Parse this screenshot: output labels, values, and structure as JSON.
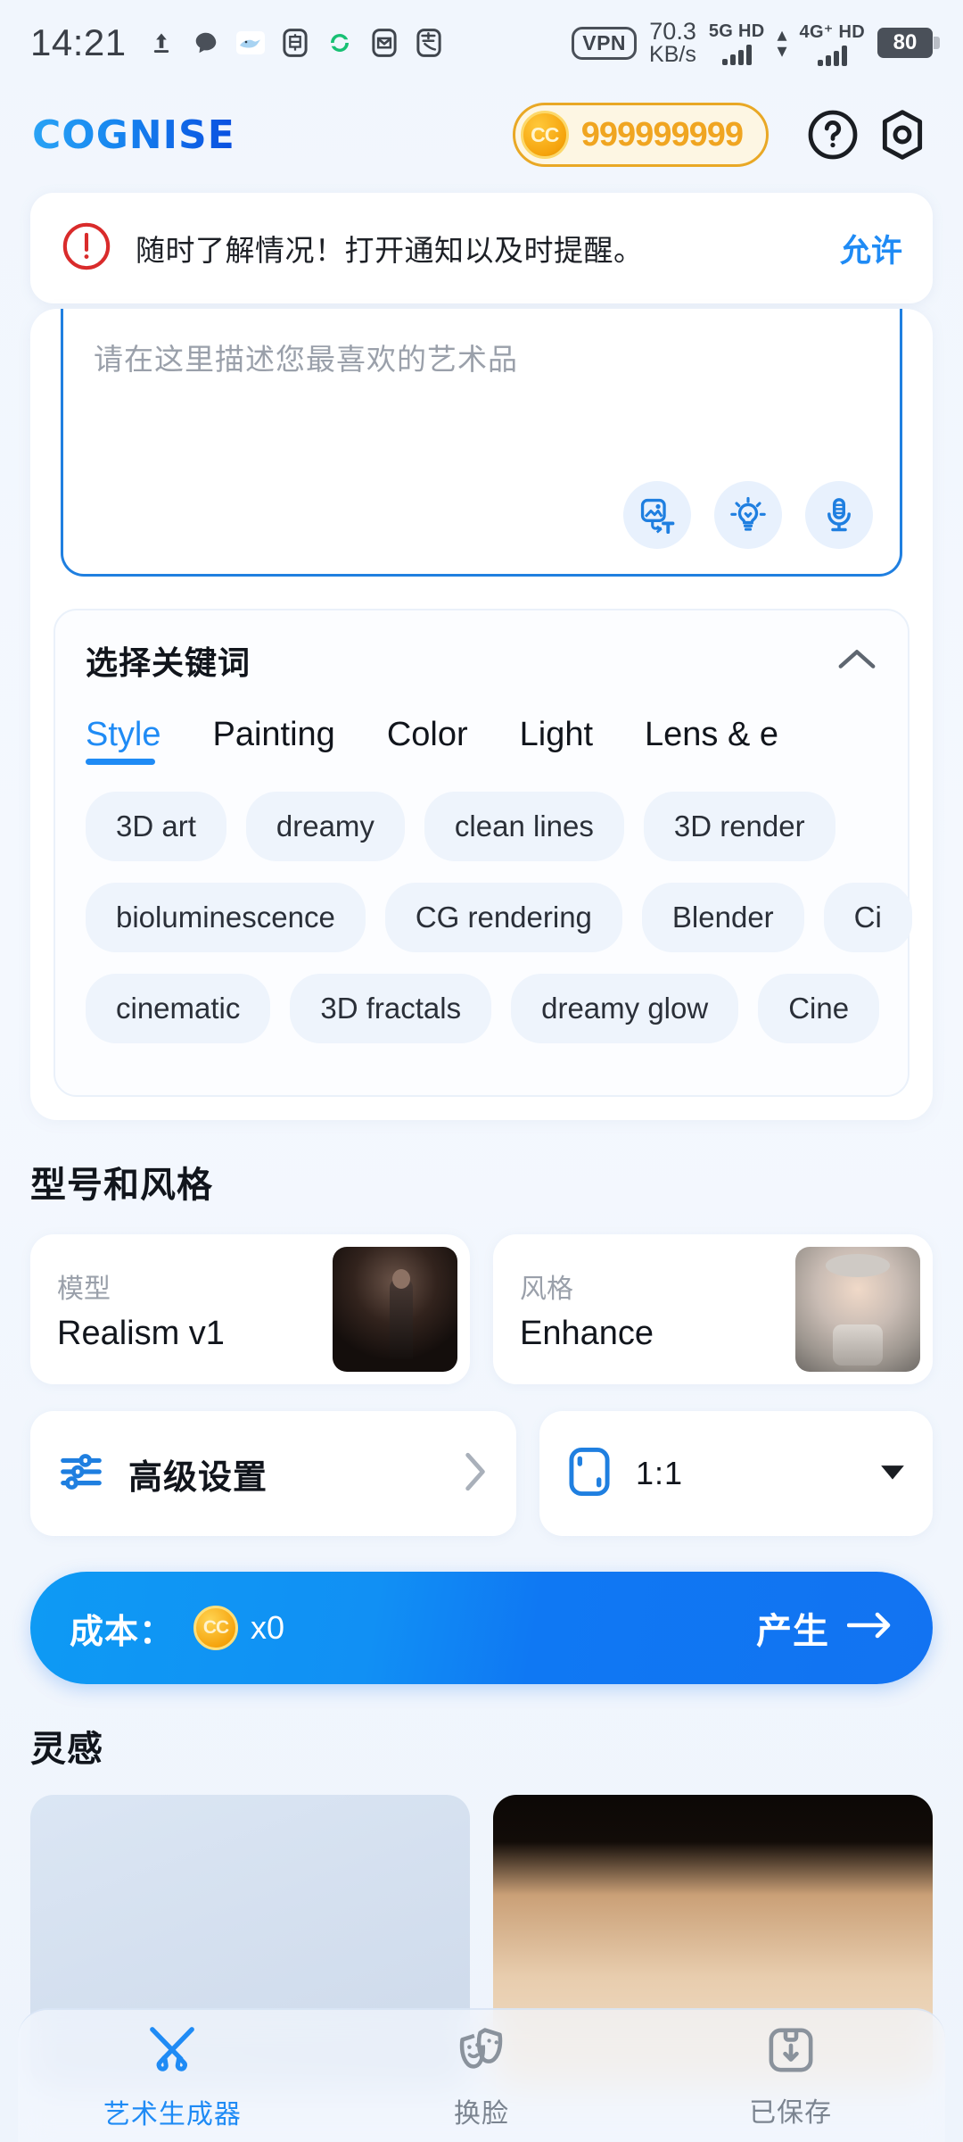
{
  "status_bar": {
    "time": "14:21",
    "left_icons": [
      "upload-icon",
      "chat-bubble-icon",
      "whale-icon",
      "bank-app-icon",
      "sync-icon",
      "mail-icon",
      "alipay-icon"
    ],
    "vpn": "VPN",
    "net_speed_value": "70.3",
    "net_speed_unit": "KB/s",
    "sim1_label": "5G HD",
    "sim2_label": "4G⁺ HD",
    "battery": "80"
  },
  "header": {
    "logo": "COGNISE",
    "credits_badge": "CC",
    "credits": "999999999",
    "help_icon": "question-mark-icon",
    "profile_icon": "hexagon-profile-icon"
  },
  "notification": {
    "icon": "alert-exclamation-icon",
    "message": "随时了解情况！打开通知以及时提醒。",
    "action": "允许"
  },
  "prompt": {
    "placeholder": "请在这里描述您最喜欢的艺术品",
    "value": "",
    "tools": [
      {
        "name": "image-to-text-icon"
      },
      {
        "name": "lightbulb-inspire-icon"
      },
      {
        "name": "microphone-icon"
      }
    ]
  },
  "keywords": {
    "title": "选择关键词",
    "collapse_icon": "chevron-up-icon",
    "tabs": [
      {
        "label": "Style",
        "active": true
      },
      {
        "label": "Painting",
        "active": false
      },
      {
        "label": "Color",
        "active": false
      },
      {
        "label": "Light",
        "active": false
      },
      {
        "label": "Lens & e",
        "active": false
      }
    ],
    "chip_rows": [
      [
        "3D art",
        "dreamy",
        "clean lines",
        "3D render"
      ],
      [
        "bioluminescence",
        "CG rendering",
        "Blender",
        "Ci"
      ],
      [
        "cinematic",
        "3D fractals",
        "dreamy glow",
        "Cine"
      ]
    ]
  },
  "model_style": {
    "section_title": "型号和风格",
    "model": {
      "label": "模型",
      "value": "Realism v1",
      "thumb": "model-preview-thumbnail"
    },
    "style": {
      "label": "风格",
      "value": "Enhance",
      "thumb": "style-preview-thumbnail"
    }
  },
  "settings": {
    "advanced_icon": "sliders-icon",
    "advanced_label": "高级设置",
    "advanced_chevron": "chevron-right-icon",
    "ratio_icon": "aspect-ratio-icon",
    "ratio_value": "1:1",
    "ratio_chevron": "caret-down-icon"
  },
  "generate": {
    "cost_label": "成本：",
    "coin_badge": "CC",
    "cost_value": "x0",
    "action_label": "产生",
    "arrow_icon": "arrow-right-icon"
  },
  "inspiration": {
    "title": "灵感",
    "cards": [
      "inspiration-image-1",
      "inspiration-image-2"
    ]
  },
  "bottom_nav": [
    {
      "label": "艺术生成器",
      "icon": "magic-brush-icon",
      "active": true
    },
    {
      "label": "换脸",
      "icon": "theatre-masks-icon",
      "active": false
    },
    {
      "label": "已保存",
      "icon": "save-box-icon",
      "active": false
    }
  ],
  "colors": {
    "accent": "#1f8bf5",
    "gold": "#f0a521",
    "alert_red": "#d92b2b",
    "page_bg": "#f2f6fd"
  }
}
